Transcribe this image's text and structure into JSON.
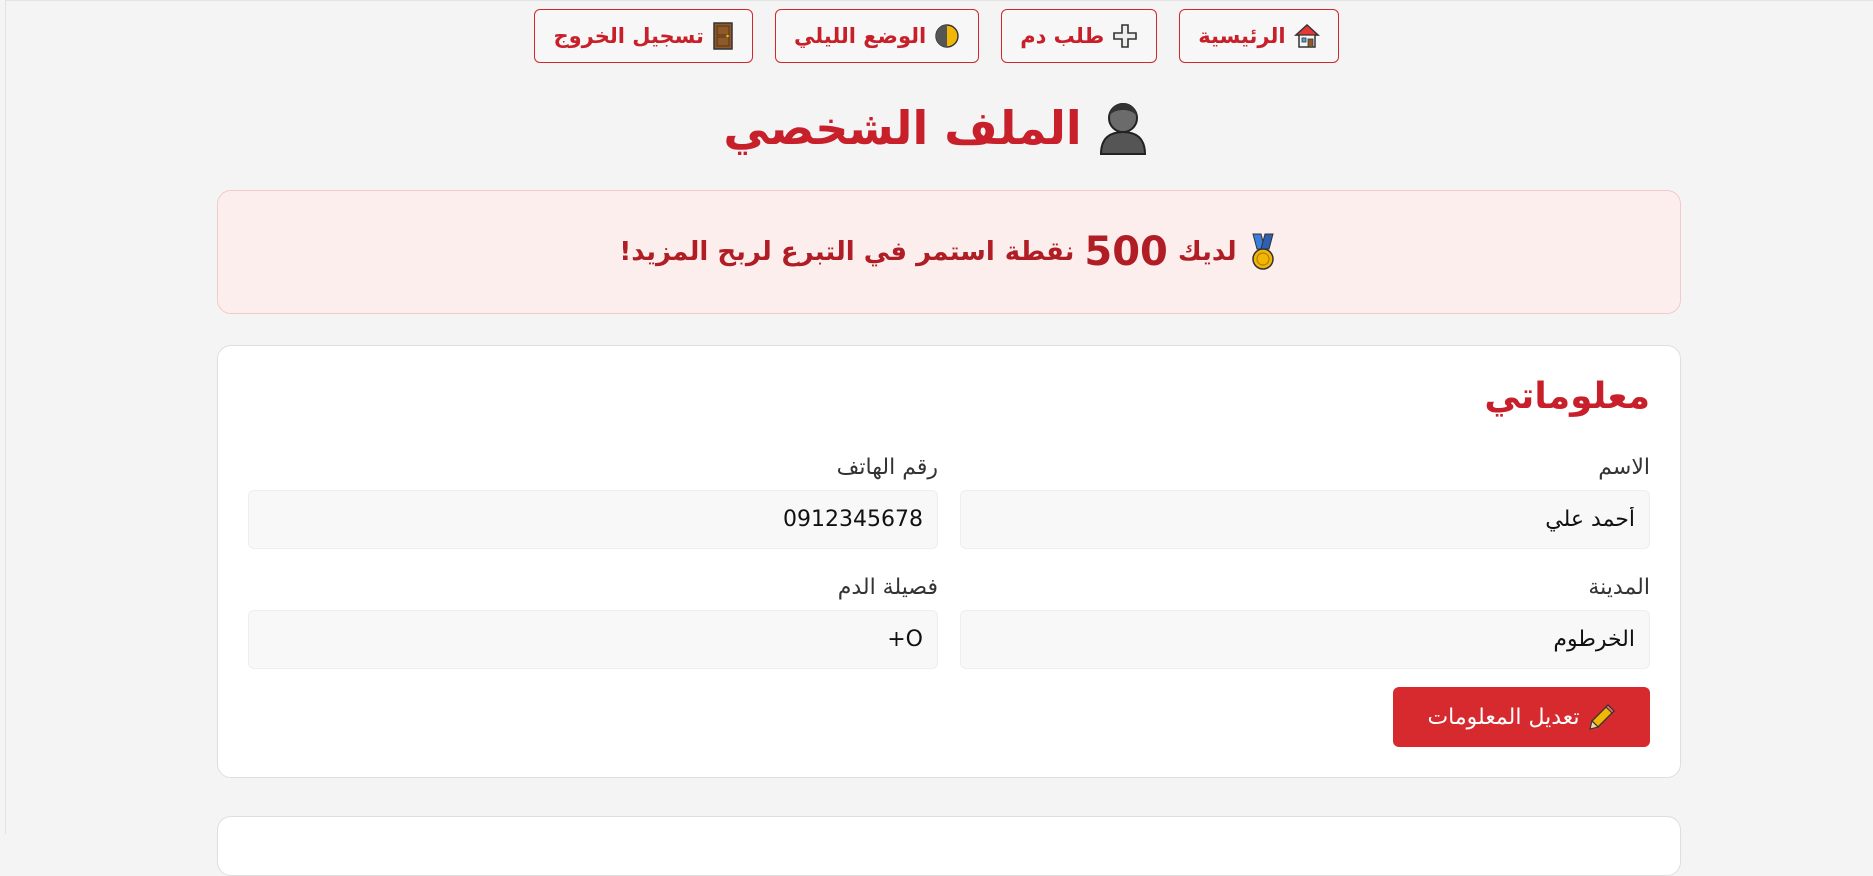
{
  "nav": {
    "items": [
      {
        "label": "الرئيسية",
        "icon": "house-icon"
      },
      {
        "label": "طلب دم",
        "icon": "plus-icon"
      },
      {
        "label": "الوضع الليلي",
        "icon": "moon-icon"
      },
      {
        "label": "تسجيل الخروج",
        "icon": "door-icon"
      }
    ]
  },
  "page": {
    "title": "الملف الشخصي",
    "title_icon": "user-icon"
  },
  "points": {
    "prefix": "لديك",
    "value": "500",
    "unit": "نقطة",
    "suffix": "استمر في التبرع لربح المزيد!",
    "icon": "medal-icon"
  },
  "profile": {
    "section_title": "معلوماتي",
    "fields": {
      "name": {
        "label": "الاسم",
        "value": "أحمد علي"
      },
      "phone": {
        "label": "رقم الهاتف",
        "value": "0912345678"
      },
      "city": {
        "label": "المدينة",
        "value": "الخرطوم"
      },
      "blood_type": {
        "label": "فصيلة الدم",
        "value": "O+"
      }
    },
    "edit_button": {
      "label": "تعديل المعلومات",
      "icon": "pencil-icon"
    }
  },
  "colors": {
    "accent": "#c8202a",
    "button_bg": "#d62a2e",
    "banner_bg": "#fdeeee",
    "banner_border": "#f2c9cc",
    "page_bg": "#f4f4f4"
  }
}
